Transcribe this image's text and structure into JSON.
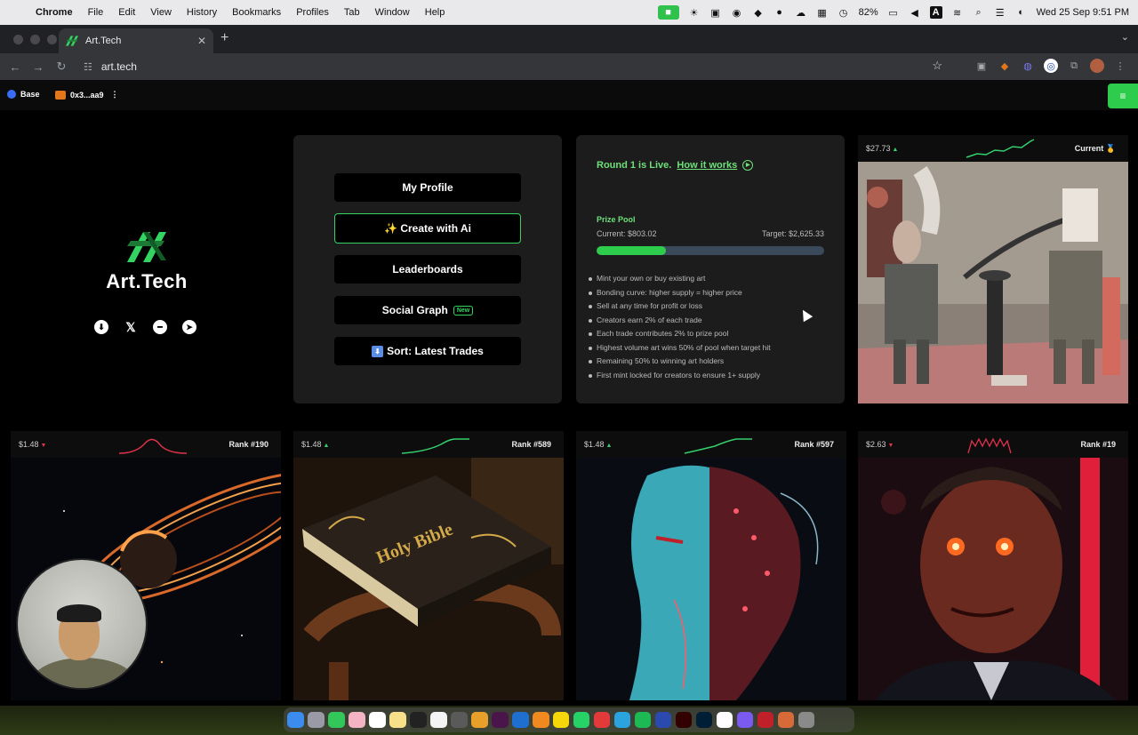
{
  "menubar": {
    "app": "Chrome",
    "items": [
      "File",
      "Edit",
      "View",
      "History",
      "Bookmarks",
      "Profiles",
      "Tab",
      "Window",
      "Help"
    ],
    "battery": "82%",
    "datetime": "Wed 25 Sep  9:51 PM"
  },
  "browser": {
    "tab_title": "Art.Tech",
    "url": "art.tech"
  },
  "site_header": {
    "chain": "Base",
    "wallet": "0x3...aa9"
  },
  "brand": {
    "name": "Art.Tech",
    "accent": "#33d462"
  },
  "menu": {
    "my_profile": "My Profile",
    "create_ai": "✨ Create with Ai",
    "leaderboards": "Leaderboards",
    "social_graph": "Social Graph",
    "social_graph_badge": "New",
    "sort": "Sort: Latest Trades"
  },
  "info": {
    "round_text": "Round 1 is Live.",
    "how_it_works": "How it works",
    "pool_title": "Prize Pool",
    "pool_current": "Current: $803.02",
    "pool_target": "Target: $2,625.33",
    "pool_progress": 0.306,
    "rules": [
      "Mint your own or buy existing art",
      "Bonding curve: higher supply = higher price",
      "Sell at any time for profit or loss",
      "Creators earn 2% of each trade",
      "Each trade contributes 2% to prize pool",
      "Highest volume art wins 50% of pool when target hit",
      "Remaining 50% to winning art holders",
      "First mint locked for creators to ensure 1+ supply"
    ]
  },
  "cards": [
    {
      "price": "$27.73",
      "trend": "up",
      "label": "Current",
      "medal": "🥇"
    },
    {
      "price": "$1.48",
      "trend": "down",
      "label": "Rank #190"
    },
    {
      "price": "$1.48",
      "trend": "up",
      "label": "Rank #589"
    },
    {
      "price": "$1.48",
      "trend": "up",
      "label": "Rank #597"
    },
    {
      "price": "$2.63",
      "trend": "down",
      "label": "Rank #19"
    }
  ],
  "card_art_text": "Holy Bible",
  "colors": {
    "up": "#35d06c",
    "down": "#e0324b"
  }
}
